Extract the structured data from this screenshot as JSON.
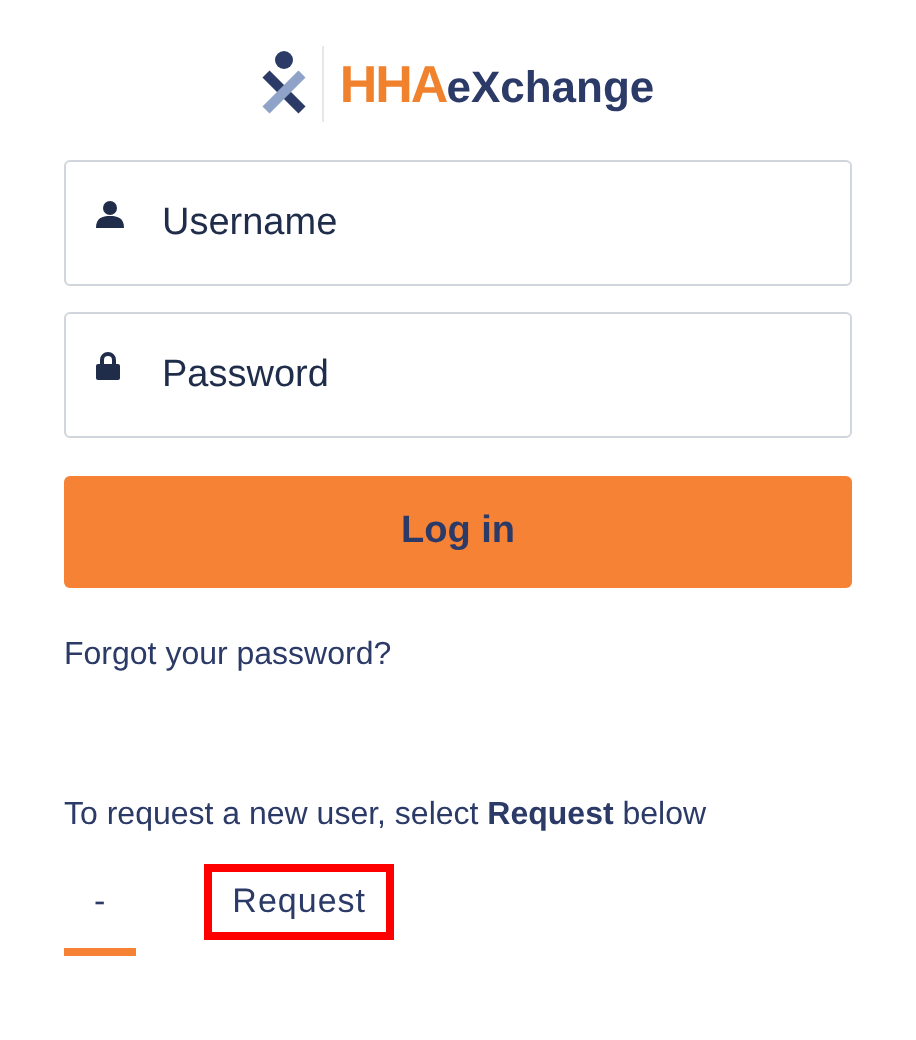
{
  "logo": {
    "brand": "HHA",
    "suffix": "eXchange"
  },
  "fields": [
    {
      "kind": "user",
      "placeholder": "Username"
    },
    {
      "kind": "lock",
      "placeholder": "Password"
    }
  ],
  "login_button": "Log in",
  "forgot_link": "Forgot your password?",
  "request_hint": "To request a new user, select **Request** below",
  "tabs": [
    {
      "label": "-",
      "selected": true,
      "highlighted": false
    },
    {
      "label": "Request",
      "selected": false,
      "highlighted": true
    }
  ]
}
